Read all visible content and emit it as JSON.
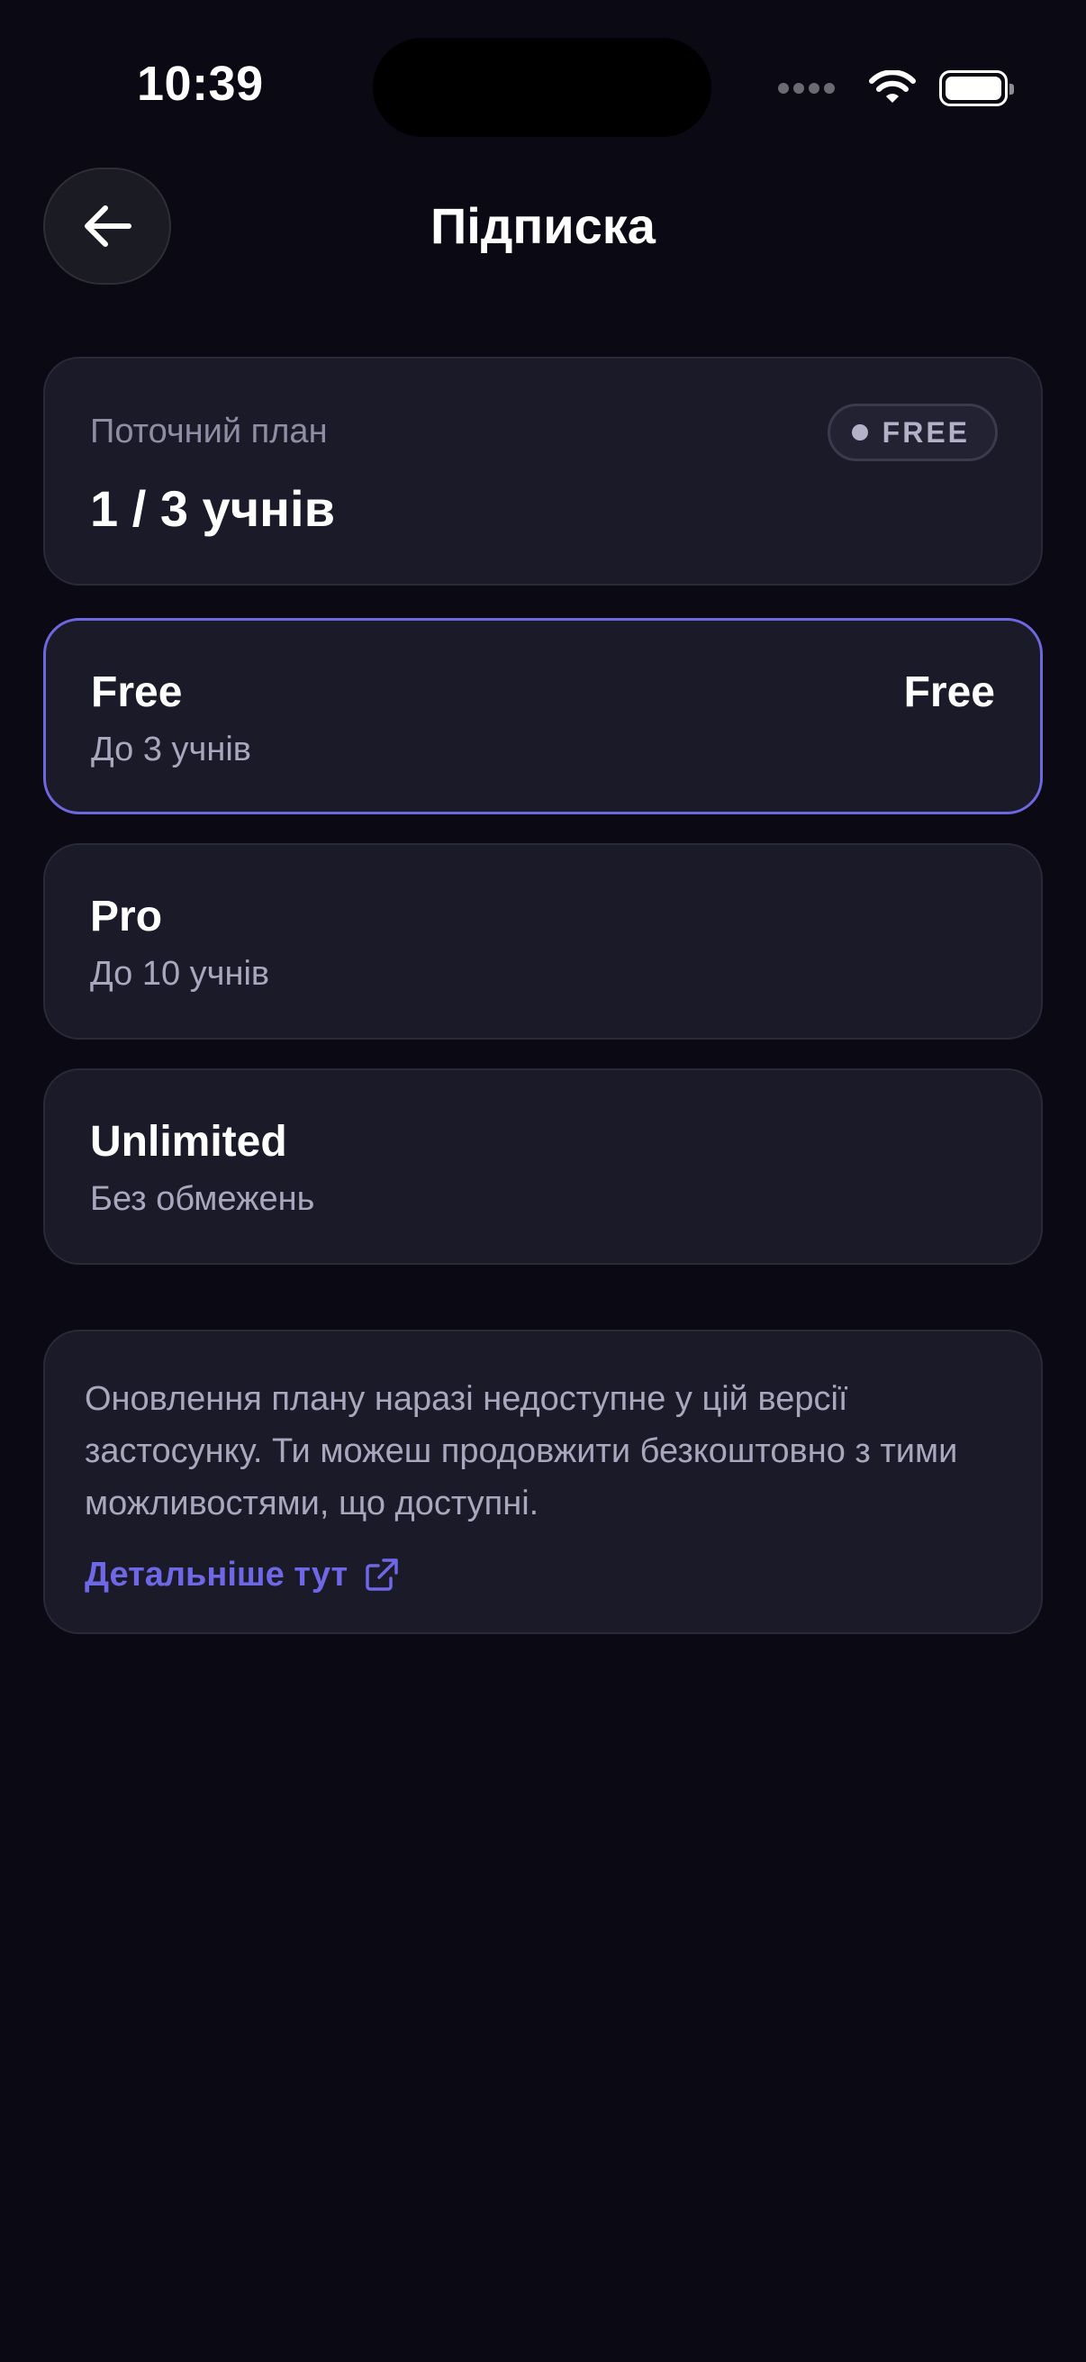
{
  "status_bar": {
    "time": "10:39"
  },
  "header": {
    "title": "Підписка",
    "back_icon": "arrow-left-icon"
  },
  "current_plan": {
    "label": "Поточний план",
    "value": "1 / 3 учнів",
    "badge": "FREE"
  },
  "plans": [
    {
      "name": "Free",
      "price": "Free",
      "description": "До 3 учнів",
      "selected": true
    },
    {
      "name": "Pro",
      "price": "",
      "description": "До 10 учнів",
      "selected": false
    },
    {
      "name": "Unlimited",
      "price": "",
      "description": "Без обмежень",
      "selected": false
    }
  ],
  "info": {
    "text": "Оновлення плану наразі недоступне у цій версії застосунку. Ти можеш продовжити безкоштовно з тими можливостями, що доступні.",
    "link_label": "Детальніше тут",
    "link_icon": "external-link-icon"
  },
  "colors": {
    "background": "#0b0a14",
    "card": "#1b1a29",
    "accent": "#6d68e0",
    "link": "#6f68e6"
  }
}
